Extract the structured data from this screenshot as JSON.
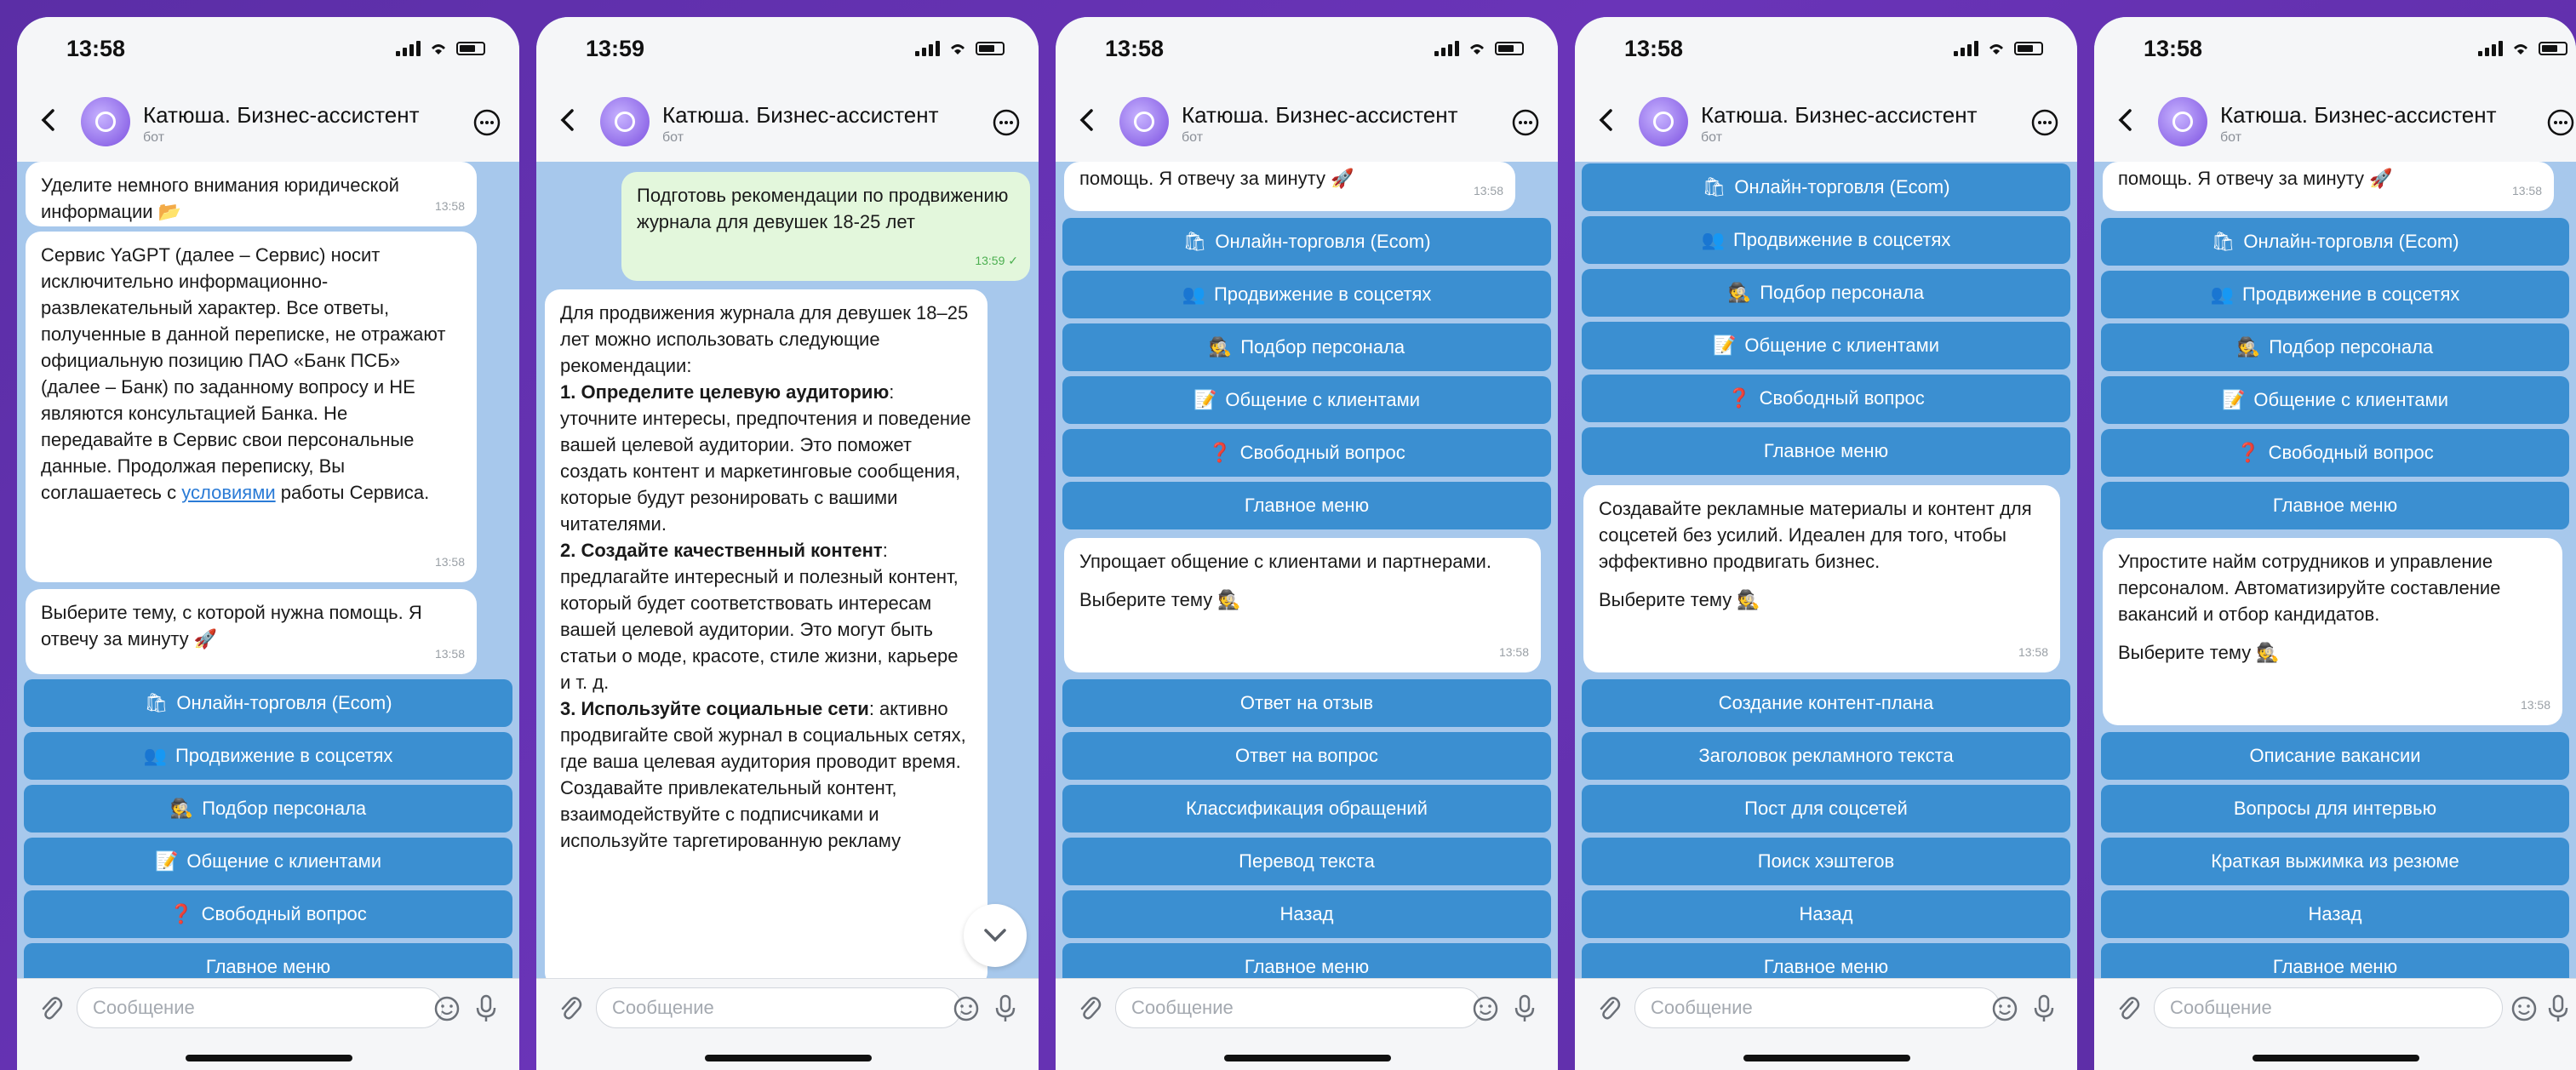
{
  "app": {
    "name": "Катюша. Бизнес-ассистент",
    "subtitle": "бот",
    "input_placeholder": "Сообщение"
  },
  "phones": [
    {
      "time": "13:58",
      "bubbles": [
        {
          "text": "Уделите немного внимания юридической информации 📂",
          "time": "13:58"
        },
        {
          "text_before": "Сервис YaGPT (далее – Сервис) носит исключительно информационно-развлекательный характер. Все ответы, полученные в данной переписке, не отражают официальную позицию ПАО «Банк ПСБ» (далее – Банк) по заданному вопросу и НЕ являются консультацией Банка. Не передавайте в Сервис свои персональные данные. Продолжая переписку, Вы соглашаетесь с ",
          "link": "условиями",
          "text_after": " работы Сервиса.",
          "time": "13:58"
        },
        {
          "text": "Выберите тему, с которой нужна помощь. Я отвечу за минуту 🚀",
          "time": "13:58"
        }
      ],
      "buttons": [
        {
          "icon": "🛍",
          "label": "Онлайн-торговля (Ecom)"
        },
        {
          "icon": "👥",
          "label": "Продвижение в соцсетях"
        },
        {
          "icon": "🕵",
          "label": "Подбор персонала"
        },
        {
          "icon": "📝",
          "label": "Общение с клиентами"
        },
        {
          "icon": "❓",
          "label": "Свободный вопрос"
        },
        {
          "icon": "",
          "label": "Главное меню"
        }
      ]
    },
    {
      "time": "13:59",
      "outgoing": {
        "text": "Подготовь рекомендации по продвижению журнала для девушек 18-25 лет",
        "time": "13:59 ✓"
      },
      "answer": {
        "intro": "Для продвижения журнала для девушек 18–25 лет можно использовать следующие рекомендации:",
        "items": [
          {
            "num": "1. ",
            "title": "Определите целевую аудиторию",
            "text": ": уточните интересы, предпочтения и поведение вашей целевой аудитории. Это поможет создать контент и маркетинговые сообщения, которые будут резонировать с вашими читателями."
          },
          {
            "num": "2. ",
            "title": "Создайте качественный контент",
            "text": ": предлагайте интересный и полезный контент, который будет соответствовать интересам вашей целевой аудитории. Это могут быть статьи о моде, красоте, стиле жизни, карьере и т. д."
          },
          {
            "num": "3. ",
            "title": "Используйте социальные сети",
            "text": ": активно продвигайте свой журнал в социальных сетях, где ваша целевая аудитория проводит время. Создавайте привлекательный контент, взаимодействуйте с подписчиками и используйте таргетированную рекламу"
          }
        ]
      }
    },
    {
      "time": "13:58",
      "top_bubble": {
        "text": "помощь. Я отвечу за минуту 🚀",
        "time": "13:58"
      },
      "buttons": [
        {
          "icon": "🛍",
          "label": "Онлайн-торговля (Ecom)"
        },
        {
          "icon": "👥",
          "label": "Продвижение в соцсетях"
        },
        {
          "icon": "🕵",
          "label": "Подбор персонала"
        },
        {
          "icon": "📝",
          "label": "Общение с клиентами"
        },
        {
          "icon": "❓",
          "label": "Свободный вопрос"
        },
        {
          "icon": "",
          "label": "Главное меню"
        }
      ],
      "bubble": {
        "text": "Упрощает общение с клиентами и партнерами.",
        "prompt": "Выберите тему 🕵",
        "time": "13:58"
      },
      "buttons2": [
        {
          "label": "Ответ на отзыв"
        },
        {
          "label": "Ответ на вопрос"
        },
        {
          "label": "Классификация обращений"
        },
        {
          "label": "Перевод текста"
        },
        {
          "label": "Назад"
        },
        {
          "label": "Главное меню"
        }
      ]
    },
    {
      "time": "13:58",
      "buttons": [
        {
          "icon": "🛍",
          "label": "Онлайн-торговля (Ecom)"
        },
        {
          "icon": "👥",
          "label": "Продвижение в соцсетях"
        },
        {
          "icon": "🕵",
          "label": "Подбор персонала"
        },
        {
          "icon": "📝",
          "label": "Общение с клиентами"
        },
        {
          "icon": "❓",
          "label": "Свободный вопрос"
        },
        {
          "icon": "",
          "label": "Главное меню"
        }
      ],
      "bubble": {
        "text": "Создавайте рекламные материалы и контент для соцсетей без усилий. Идеален для того, чтобы эффективно продвигать бизнес.",
        "prompt": "Выберите тему 🕵",
        "time": "13:58"
      },
      "buttons2": [
        {
          "label": "Создание контент-плана"
        },
        {
          "label": "Заголовок рекламного текста"
        },
        {
          "label": "Пост для соцсетей"
        },
        {
          "label": "Поиск хэштегов"
        },
        {
          "label": "Назад"
        },
        {
          "label": "Главное меню"
        }
      ]
    },
    {
      "time": "13:58",
      "top_bubble": {
        "text": "помощь. Я отвечу за минуту 🚀",
        "time": "13:58"
      },
      "buttons": [
        {
          "icon": "🛍",
          "label": "Онлайн-торговля (Ecom)"
        },
        {
          "icon": "👥",
          "label": "Продвижение в соцсетях"
        },
        {
          "icon": "🕵",
          "label": "Подбор персонала"
        },
        {
          "icon": "📝",
          "label": "Общение с клиентами"
        },
        {
          "icon": "❓",
          "label": "Свободный вопрос"
        },
        {
          "icon": "",
          "label": "Главное меню"
        }
      ],
      "bubble": {
        "text": "Упростите найм сотрудников и управление персоналом. Автоматизируйте составление вакансий и отбор кандидатов.",
        "prompt": "Выберите тему 🕵",
        "time": "13:58"
      },
      "buttons2": [
        {
          "label": "Описание вакансии"
        },
        {
          "label": "Вопросы для интервью"
        },
        {
          "label": "Краткая выжимка из резюме"
        },
        {
          "label": "Назад"
        },
        {
          "label": "Главное меню"
        }
      ]
    }
  ]
}
